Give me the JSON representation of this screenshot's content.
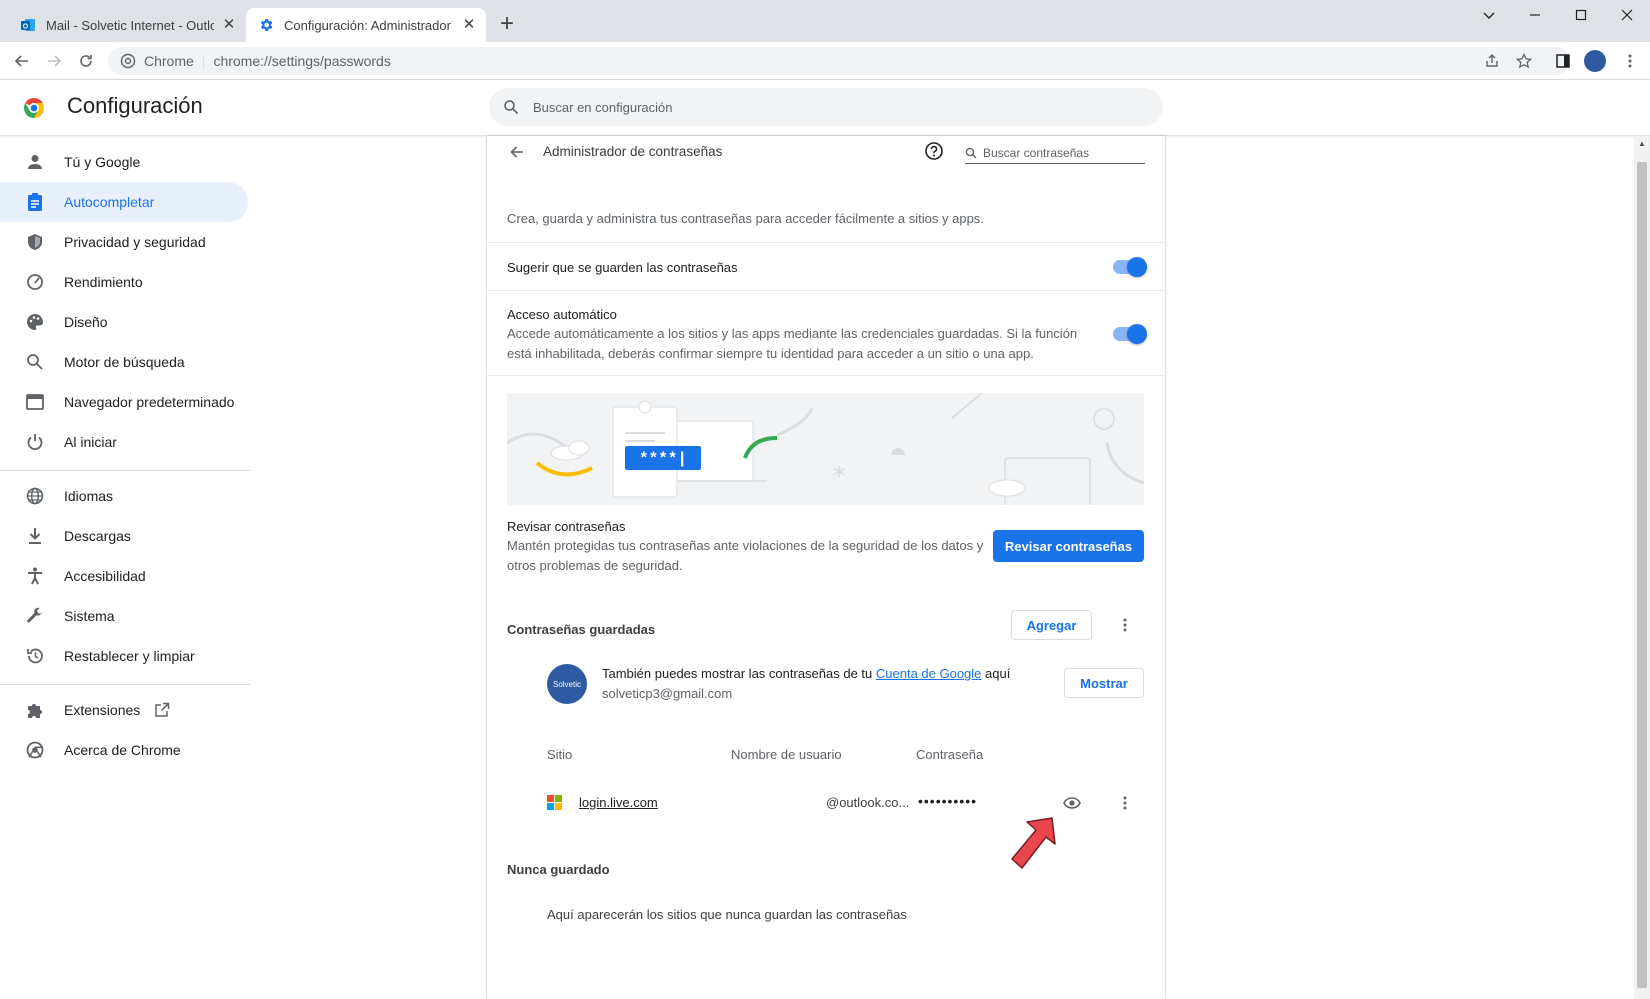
{
  "tabs": [
    {
      "title": "Mail - Solvetic Internet - Outlook",
      "icon": "outlook-icon",
      "active": false
    },
    {
      "title": "Configuración: Administrador de",
      "icon": "settings-gear-icon",
      "active": true
    }
  ],
  "toolbar": {
    "site_label": "Chrome",
    "url": "chrome://settings/passwords"
  },
  "header": {
    "title": "Configuración",
    "search_placeholder": "Buscar en configuración"
  },
  "sidebar": {
    "items": [
      {
        "label": "Tú y Google",
        "icon": "person-icon"
      },
      {
        "label": "Autocompletar",
        "icon": "clipboard-icon",
        "active": true
      },
      {
        "label": "Privacidad y seguridad",
        "icon": "shield-icon"
      },
      {
        "label": "Rendimiento",
        "icon": "speedometer-icon"
      },
      {
        "label": "Diseño",
        "icon": "palette-icon"
      },
      {
        "label": "Motor de búsqueda",
        "icon": "search-icon"
      },
      {
        "label": "Navegador predeterminado",
        "icon": "browser-icon"
      },
      {
        "label": "Al iniciar",
        "icon": "power-icon"
      },
      {
        "label": "Idiomas",
        "icon": "globe-icon"
      },
      {
        "label": "Descargas",
        "icon": "download-icon"
      },
      {
        "label": "Accesibilidad",
        "icon": "accessibility-icon"
      },
      {
        "label": "Sistema",
        "icon": "wrench-icon"
      },
      {
        "label": "Restablecer y limpiar",
        "icon": "restore-icon"
      },
      {
        "label": "Extensiones",
        "icon": "puzzle-icon"
      },
      {
        "label": "Acerca de Chrome",
        "icon": "chrome-icon"
      }
    ]
  },
  "passwords": {
    "title": "Administrador de contraseñas",
    "search_placeholder": "Buscar contraseñas",
    "intro": "Crea, guarda y administra tus contraseñas para acceder fácilmente a sitios y apps.",
    "offer_save": {
      "label": "Sugerir que se guarden las contraseñas",
      "enabled": true
    },
    "auto_signin": {
      "label": "Acceso automático",
      "desc_line1": "Accede automáticamente a los sitios y las apps mediante las credenciales guardadas. Si la función",
      "desc_line2": "está inhabilitada, deberás confirmar siempre tu identidad para acceder a un sitio o una app.",
      "enabled": true
    },
    "illustration_text": "****|",
    "check": {
      "title": "Revisar contraseñas",
      "desc_line1": "Mantén protegidas tus contraseñas ante violaciones de la seguridad de los datos y",
      "desc_line2": "otros problemas de seguridad.",
      "button": "Revisar contraseñas"
    },
    "saved": {
      "title": "Contraseñas guardadas",
      "add_button": "Agregar",
      "account_prefix": "También puedes mostrar las contraseñas de tu ",
      "account_link": "Cuenta de Google",
      "account_suffix": " aquí",
      "account_email": "solveticp3@gmail.com",
      "avatar_text": "Solvetic",
      "show_button": "Mostrar",
      "columns": [
        "Sitio",
        "Nombre de usuario",
        "Contraseña"
      ],
      "rows": [
        {
          "site": "login.live.com",
          "username": "@outlook.co...",
          "password": "••••••••••"
        }
      ]
    },
    "never": {
      "title": "Nunca guardado",
      "empty": "Aquí aparecerán los sitios que nunca guardan las contraseñas"
    }
  },
  "colors": {
    "accent": "#1a73e8",
    "annotation_arrow": "#e8454d"
  }
}
